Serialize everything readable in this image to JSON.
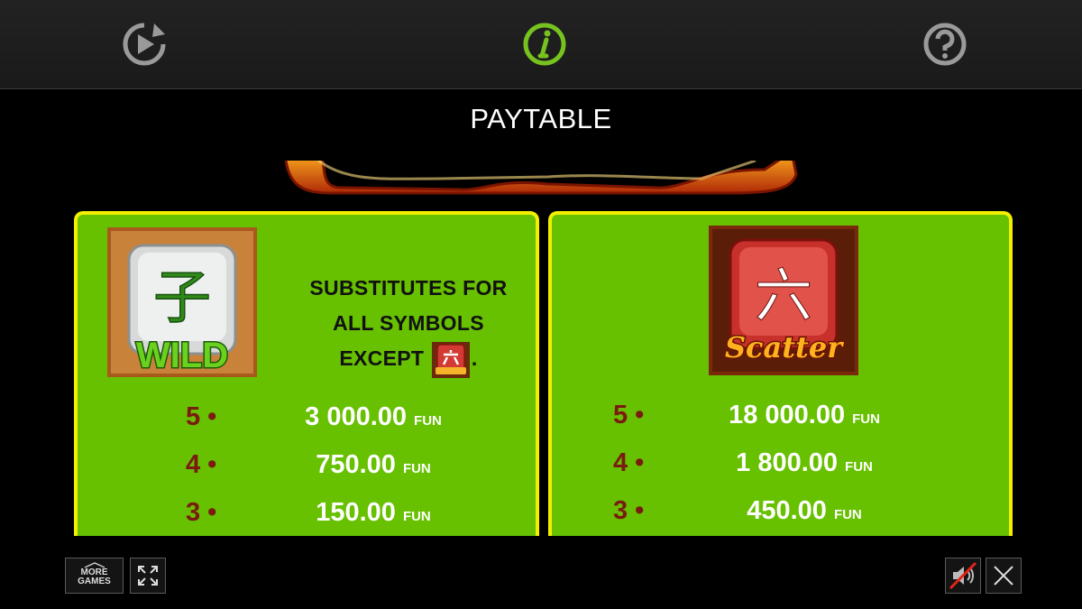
{
  "topbar": {
    "icons": [
      "replay-icon",
      "info-icon",
      "help-icon"
    ]
  },
  "title": "PAYTABLE",
  "wild_card": {
    "symbol_label": "WILD",
    "symbol_glyph": "子",
    "description_lines": [
      "SUBSTITUTES FOR",
      "ALL SYMBOLS",
      "EXCEPT"
    ],
    "description_end": ".",
    "payouts": [
      {
        "count": "5 •",
        "amount": "3 000.00",
        "unit": "FUN"
      },
      {
        "count": "4 •",
        "amount": "750.00",
        "unit": "FUN"
      },
      {
        "count": "3 •",
        "amount": "150.00",
        "unit": "FUN"
      }
    ]
  },
  "scatter_card": {
    "symbol_label": "Scatter",
    "symbol_glyph": "六",
    "payouts": [
      {
        "count": "5 •",
        "amount": "18 000.00",
        "unit": "FUN"
      },
      {
        "count": "4 •",
        "amount": "1 800.00",
        "unit": "FUN"
      },
      {
        "count": "3 •",
        "amount": "450.00",
        "unit": "FUN"
      }
    ]
  },
  "bottom": {
    "more_games_line1": "MORE",
    "more_games_line2": "GAMES"
  },
  "colors": {
    "card_bg": "#67c000",
    "card_border": "#f2f000",
    "count_color": "#7a1a10"
  }
}
